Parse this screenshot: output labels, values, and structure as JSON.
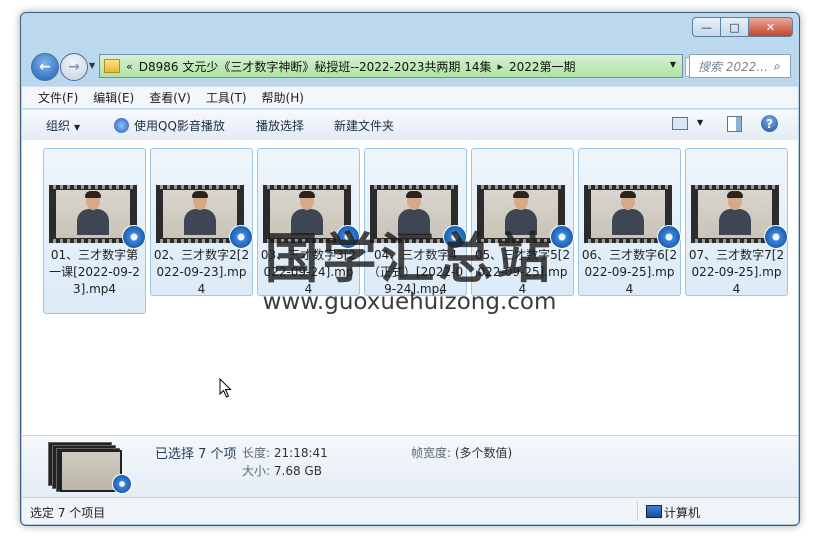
{
  "window": {
    "buttons": {
      "minimize": "—",
      "maximize": "□",
      "close": "✕"
    }
  },
  "nav": {
    "back_icon": "back-arrow-icon",
    "forward_icon": "forward-arrow-icon",
    "breadcrumb_overflow": "«",
    "path": [
      "D8986 文元少《三才数字神断》秘授班--2022-2023共两期 14集",
      "2022第一期"
    ],
    "separator": "▸",
    "search_placeholder": "搜索 2022..."
  },
  "menu": {
    "items": [
      "文件(F)",
      "编辑(E)",
      "查看(V)",
      "工具(T)",
      "帮助(H)"
    ]
  },
  "toolbar": {
    "organize": "组织",
    "play_qq": "使用QQ影音播放",
    "play_selection": "播放选择",
    "new_folder": "新建文件夹"
  },
  "files": [
    {
      "name": "01、三才数字第一课[2022-09-23].mp4",
      "selected": true
    },
    {
      "name": "02、三才数字2[2022-09-23].mp4",
      "selected": true
    },
    {
      "name": "03、三才数字3[2022-09-24].mp4",
      "selected": true
    },
    {
      "name": "04、三才数字4（正式）[2022-09-24].mp4",
      "selected": true
    },
    {
      "name": "05、三才数字5[2022-09-25].mp4",
      "selected": true
    },
    {
      "name": "06、三才数字6[2022-09-25].mp4",
      "selected": true
    },
    {
      "name": "07、三才数字7[2022-09-25].mp4",
      "selected": true
    }
  ],
  "details": {
    "selected_count": "已选择 7 个项",
    "length_label": "长度:",
    "length_value": "21:18:41",
    "size_label": "大小:",
    "size_value": "7.68 GB",
    "frame_width_label": "帧宽度:",
    "frame_width_value": "(多个数值)"
  },
  "status": {
    "text": "选定 7 个项目",
    "location": "计算机"
  },
  "watermark": {
    "cn": "国学汇总站",
    "en": "www.guoxuehuizong.com"
  },
  "colors": {
    "address_bar": "#aee4a4",
    "selection": "#dcebf8",
    "accent": "#1d5fb6"
  }
}
